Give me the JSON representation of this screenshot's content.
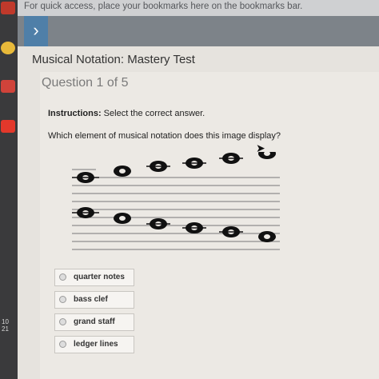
{
  "browser": {
    "bookmarks_hint": "For quick access, place your bookmarks here on the bookmarks bar."
  },
  "taskbar": {
    "date_line1": "10",
    "date_line2": "21"
  },
  "test": {
    "title": "Musical Notation: Mastery Test",
    "question_label": "Question 1 of 5",
    "instructions_label": "Instructions:",
    "instructions_text": " Select the correct answer.",
    "prompt": "Which element of musical notation does this image display?"
  },
  "choices": [
    {
      "label": "quarter notes"
    },
    {
      "label": "bass clef"
    },
    {
      "label": "grand staff"
    },
    {
      "label": "ledger lines"
    }
  ],
  "colors": {
    "nav_accent": "#4f7fa8",
    "gmail_red": "#d0433a",
    "youtube_red": "#e3382b"
  }
}
